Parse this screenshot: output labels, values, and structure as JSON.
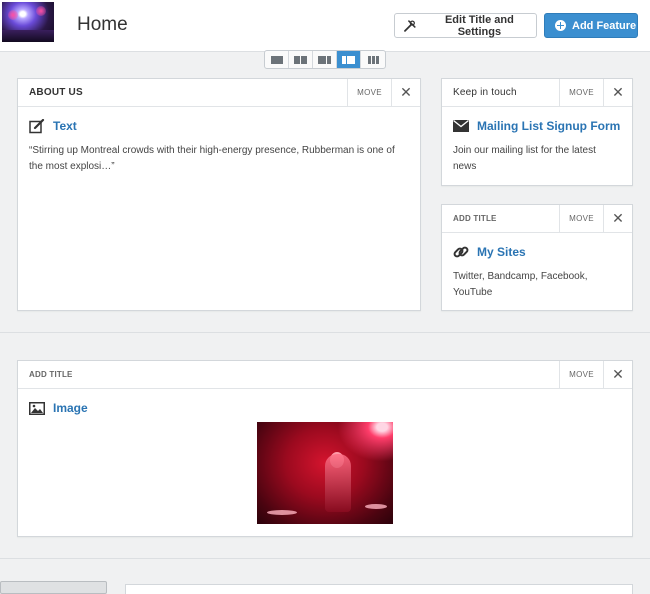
{
  "header": {
    "page_title": "Home",
    "edit_settings_label": "Edit Title and Settings",
    "add_feature_label": "Add Feature"
  },
  "layout_switcher": {
    "options": [
      "one-column",
      "two-equal-columns",
      "wide-left",
      "wide-right-active",
      "three-columns"
    ],
    "active_index": 3
  },
  "about_card": {
    "title": "ABOUT US",
    "move_label": "MOVE",
    "feature_icon": "edit-icon",
    "feature_label": "Text",
    "text": "“Stirring up Montreal crowds with their high-energy presence, Rubberman is one of the most explosi…”"
  },
  "keep_card": {
    "title": "Keep in touch",
    "move_label": "MOVE",
    "feature_icon": "envelope-icon",
    "feature_label": "Mailing List Signup Form",
    "text": "Join our mailing list for the latest news"
  },
  "sites_card": {
    "title": "ADD TITLE",
    "move_label": "MOVE",
    "feature_icon": "link-icon",
    "feature_label": "My Sites",
    "text": "Twitter, Bandcamp, Facebook, YouTube"
  },
  "image_card": {
    "title": "ADD TITLE",
    "move_label": "MOVE",
    "feature_icon": "image-icon",
    "feature_label": "Image"
  },
  "colors": {
    "accent": "#3b8fd0",
    "link": "#2a74b3",
    "background": "#f0f1f2"
  }
}
